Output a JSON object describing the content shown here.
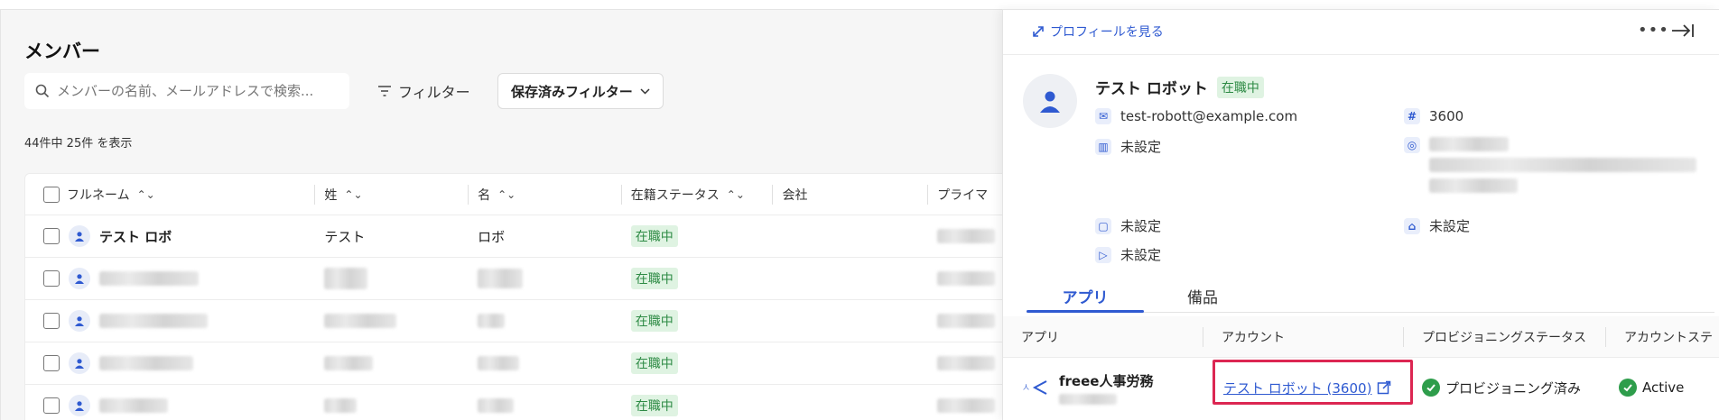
{
  "members_panel": {
    "title": "メンバー",
    "search_placeholder": "メンバーの名前、メールアドレスで検索...",
    "filter_label": "フィルター",
    "saved_filter_label": "保存済みフィルター",
    "result_count": "44件中 25件 を表示",
    "columns": [
      "フルネーム",
      "姓",
      "名",
      "在籍ステータス",
      "会社",
      "プライマ"
    ],
    "rows": [
      {
        "full_name": "テスト ロボ",
        "last_name": "テスト",
        "first_name": "ロボ",
        "status": "在職中"
      },
      {
        "full_name": "",
        "last_name": "",
        "first_name": "",
        "status": "在職中"
      },
      {
        "full_name": "",
        "last_name": "",
        "first_name": "",
        "status": "在職中"
      },
      {
        "full_name": "",
        "last_name": "",
        "first_name": "",
        "status": "在職中"
      },
      {
        "full_name": "",
        "last_name": "",
        "first_name": "",
        "status": "在職中"
      }
    ]
  },
  "drawer": {
    "view_profile_label": "プロフィールを見る",
    "more_icon": "ellipsis-icon",
    "collapse_icon": "collapse-right-icon",
    "profile": {
      "name": "テスト ロボット",
      "status_badge": "在職中",
      "email": "test-robott@example.com",
      "employee_number": "3600",
      "department": "未設定",
      "work_location": "未設定",
      "job_title": "未設定",
      "label": "未設定"
    },
    "tabs": [
      "アプリ",
      "備品"
    ],
    "app_columns": [
      "アプリ",
      "アカウント",
      "プロビジョニングステータス",
      "アカウントステ"
    ],
    "apps": [
      {
        "app_name": "freee人事労務",
        "account": "テスト ロボット (3600)",
        "provisioning_status": "プロビジョニング済み",
        "account_status": "Active"
      }
    ]
  },
  "colors": {
    "accent": "#2f5ad1",
    "success": "#2e9d4b",
    "badge_bg": "#dff3e2",
    "highlight": "#dc2652"
  }
}
